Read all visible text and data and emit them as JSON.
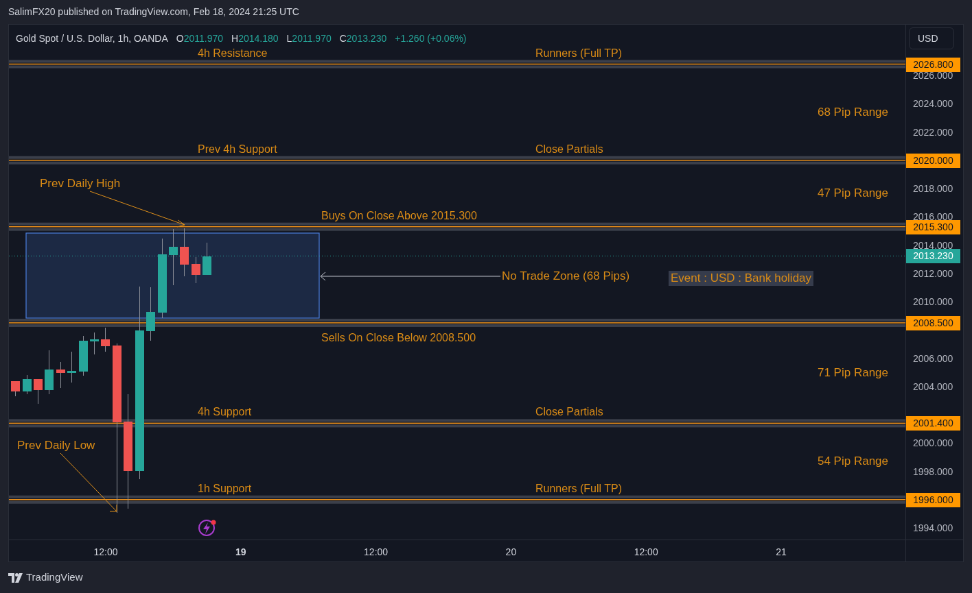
{
  "header": {
    "text": "SalimFX20 published on TradingView.com, Feb 18, 2024 21:25 UTC"
  },
  "legend": {
    "symbol": "Gold Spot / U.S. Dollar, 1h, OANDA",
    "ohlc": [
      {
        "label": "O",
        "value": "2011.970"
      },
      {
        "label": "H",
        "value": "2014.180"
      },
      {
        "label": "L",
        "value": "2011.970"
      },
      {
        "label": "C",
        "value": "2013.230"
      }
    ],
    "change": "+1.260 (+0.06%)"
  },
  "levels": [
    {
      "price": "2026.800",
      "labels": [
        {
          "kind": "left",
          "text": "4h Resistance",
          "below": false
        },
        {
          "kind": "right",
          "text": "Runners (Full TP)",
          "below": false
        }
      ],
      "range": "68 Pip Range"
    },
    {
      "price": "2020.000",
      "labels": [
        {
          "kind": "left",
          "text": "Prev 4h Support",
          "below": false
        },
        {
          "kind": "right",
          "text": "Close Partials",
          "below": false
        }
      ],
      "range": "47 Pip Range"
    },
    {
      "price": "2015.300",
      "labels": [
        {
          "kind": "middle",
          "text": "Buys On Close Above 2015.300",
          "below": false
        }
      ]
    },
    {
      "price": "2008.500",
      "labels": [
        {
          "kind": "middle",
          "text": "Sells On Close Below 2008.500",
          "below": true
        }
      ],
      "range": "71 Pip Range"
    },
    {
      "price": "2001.400",
      "labels": [
        {
          "kind": "left",
          "text": "4h Support",
          "below": false
        },
        {
          "kind": "right",
          "text": "Close Partials",
          "below": false
        }
      ],
      "range": "54 Pip Range"
    },
    {
      "price": "1996.000",
      "labels": [
        {
          "kind": "left",
          "text": "1h Support",
          "below": false
        },
        {
          "kind": "right",
          "text": "Runners (Full TP)",
          "below": false
        }
      ]
    }
  ],
  "annotations": {
    "prev_high": "Prev Daily High",
    "prev_low": "Prev Daily Low",
    "no_trade_zone": "No Trade Zone (68 Pips)",
    "event": "Event : USD : Bank holiday"
  },
  "current_price": "2013.230",
  "price_axis": {
    "currency": "USD",
    "ticks": [
      "2026.000",
      "2024.000",
      "2022.000",
      "2018.000",
      "2016.000",
      "2014.000",
      "2012.000",
      "2010.000",
      "2006.000",
      "2004.000",
      "2000.000",
      "1998.000",
      "1994.000"
    ]
  },
  "time_axis": [
    {
      "label": "12:00",
      "bold": false
    },
    {
      "label": "19",
      "bold": true
    },
    {
      "label": "12:00",
      "bold": false
    },
    {
      "label": "20",
      "bold": false
    },
    {
      "label": "12:00",
      "bold": false
    },
    {
      "label": "21",
      "bold": false
    }
  ],
  "footer": {
    "brand": "TradingView"
  }
}
